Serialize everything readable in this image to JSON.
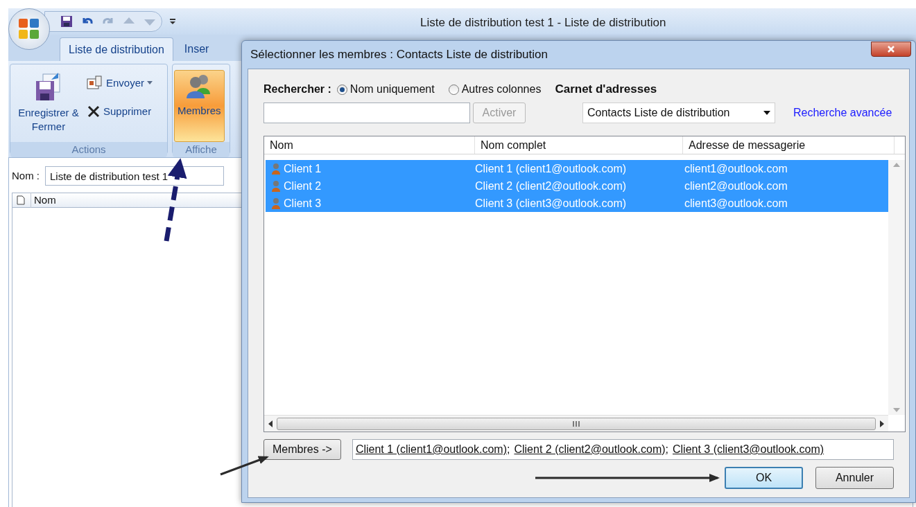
{
  "main_window": {
    "title": "Liste de distribution test 1 - Liste de distribution",
    "tabs": [
      {
        "label": "Liste de distribution",
        "selected": true
      },
      {
        "label": "Inser",
        "selected": false
      }
    ],
    "ribbon_groups": [
      {
        "label": "Actions",
        "buttons": [
          {
            "label": "Enregistrer & Fermer",
            "kind": "large",
            "selected": false
          },
          {
            "label": "Envoyer",
            "kind": "dropdown",
            "selected": false
          },
          {
            "label": "Supprimer",
            "kind": "small",
            "selected": false
          }
        ]
      },
      {
        "label": "Affiche",
        "buttons": [
          {
            "label": "Membres",
            "kind": "large",
            "selected": true
          }
        ]
      }
    ],
    "name_label": "Nom :",
    "name_value": "Liste de distribution test 1",
    "list_columns": [
      "Nom"
    ]
  },
  "dialog": {
    "title": "Sélectionner les membres : Contacts Liste de distribution",
    "search_label": "Rechercher :",
    "search_scope": [
      {
        "label": "Nom uniquement",
        "selected": true
      },
      {
        "label": "Autres colonnes",
        "selected": false
      }
    ],
    "address_book_label": "Carnet d'adresses",
    "go_button": {
      "label": "Activer",
      "disabled": true
    },
    "address_book": "Contacts Liste de distribution",
    "advanced_search": "Recherche avancée",
    "columns": [
      "Nom",
      "Nom complet",
      "Adresse de messagerie"
    ],
    "rows": [
      {
        "cells": [
          "Client 1",
          "Client 1 (client1@outlook.com)",
          "client1@outlook.com"
        ],
        "selected": true
      },
      {
        "cells": [
          "Client 2",
          "Client 2 (client2@outlook.com)",
          "client2@outlook.com"
        ],
        "selected": true
      },
      {
        "cells": [
          "Client 3",
          "Client 3 (client3@outlook.com)",
          "client3@outlook.com"
        ],
        "selected": true
      }
    ],
    "members_button": "Membres ->",
    "members": [
      "Client 1 (client1@outlook.com)",
      "Client 2 (client2@outlook.com)",
      "Client 3 (client3@outlook.com)"
    ],
    "separator": ";",
    "buttons": [
      {
        "label": "OK",
        "default": true
      },
      {
        "label": "Annuler",
        "default": false
      }
    ]
  }
}
